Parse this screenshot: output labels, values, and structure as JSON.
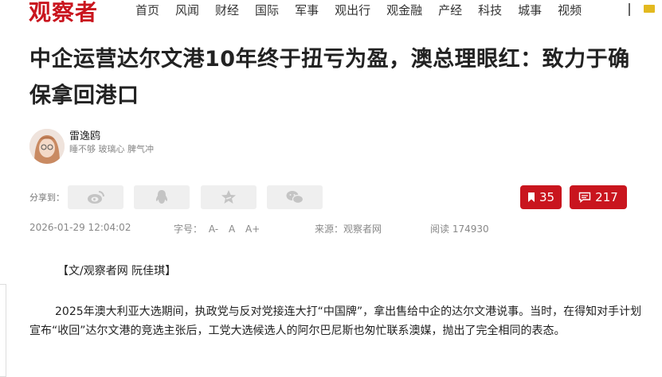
{
  "site": {
    "logo": "观察者"
  },
  "nav": {
    "items": [
      "首页",
      "风闻",
      "财经",
      "国际",
      "军事",
      "观出行",
      "观金融",
      "产经",
      "科技",
      "城事",
      "视频"
    ],
    "separator": "|"
  },
  "article": {
    "title": "中企运营达尔文港10年终于扭亏为盈，澳总理眼红：致力于确保拿回港口",
    "author": {
      "name": "雷逸鸥",
      "tagline": "睡不够 玻璃心 脾气冲"
    },
    "share_label": "分享到：",
    "share_icons": [
      "weibo-icon",
      "qq-icon",
      "qzone-star-icon",
      "wechat-icon"
    ],
    "bookmark_count": "35",
    "comment_count": "217",
    "date": "2026-01-29 12:04:02",
    "font_size_label": "字号：",
    "font_sizes": [
      "A-",
      "A",
      "A+"
    ],
    "source": "来源：观察者网",
    "views": "阅读 174930",
    "byline": "【文/观察者网 阮佳琪】",
    "paragraph": "2025年澳大利亚大选期间，执政党与反对党接连大打“中国牌”，拿出售给中企的达尔文港说事。当时，在得知对手计划宣布“收回”达尔文港的竞选主张后，工党大选候选人的阿尔巴尼斯也匆忙联系澳媒，抛出了完全相同的表态。"
  },
  "colors": {
    "brand_red": "#c9151e",
    "share_bg": "#efefef",
    "share_icon": "#c4c4c4"
  }
}
